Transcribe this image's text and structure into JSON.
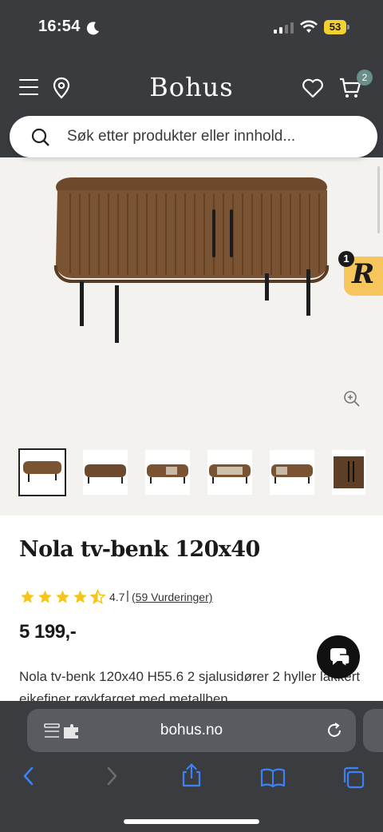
{
  "status_bar": {
    "time": "16:54",
    "battery": "53"
  },
  "header": {
    "brand": "Bohus",
    "cart_count": "2"
  },
  "search": {
    "placeholder": "Søk etter produkter eller innhold..."
  },
  "widget": {
    "letter": "R",
    "badge": "1"
  },
  "product": {
    "title": "Nola tv-benk 120x40",
    "rating": {
      "value": "4.7",
      "separator": "|",
      "reviews_link": "(59 Vurderinger)",
      "stars": 4.5
    },
    "price": "5 199,-",
    "description": "Nola tv-benk 120x40 H55.6 2 sjalusidører 2 hyller lakkert eikefiner røykfarget med metallben"
  },
  "browser": {
    "url": "bohus.no"
  },
  "colors": {
    "header_bg": "#3a3b3f",
    "gallery_bg": "#f4f2ef",
    "star": "#f5c518",
    "safari_blue": "#3b82f6"
  }
}
